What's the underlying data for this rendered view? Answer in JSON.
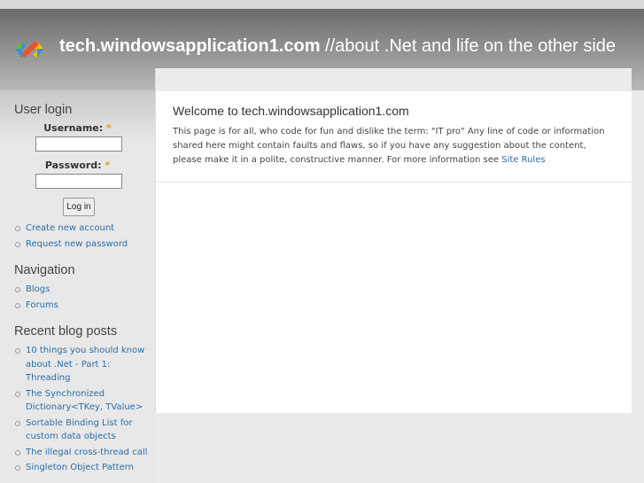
{
  "header": {
    "site_name": "tech.windowsapplication1.com",
    "slogan": " //about .Net and life on the other side"
  },
  "login": {
    "title": "User login",
    "username_label": "Username:",
    "password_label": "Password:",
    "required": "*",
    "button": "Log in",
    "links": [
      "Create new account",
      "Request new password"
    ]
  },
  "navigation": {
    "title": "Navigation",
    "items": [
      "Blogs",
      "Forums"
    ]
  },
  "recent": {
    "title": "Recent blog posts",
    "items": [
      "10 things you should know about .Net - Part 1: Threading",
      "The Synchronized Dictionary<TKey, TValue>",
      "Sortable Binding List for custom data objects",
      "The illegal cross-thread call",
      "Singleton Object Pattern"
    ]
  },
  "main": {
    "title": "Welcome to tech.windowsapplication1.com",
    "body": "This page is for all, who code for fun and dislike the term: \"IT pro\" Any line of code or information shared here might contain faults and flaws, so if you have any suggestion about the content, please make it in a polite, constructive manner. For more information see ",
    "link": "Site Rules"
  }
}
